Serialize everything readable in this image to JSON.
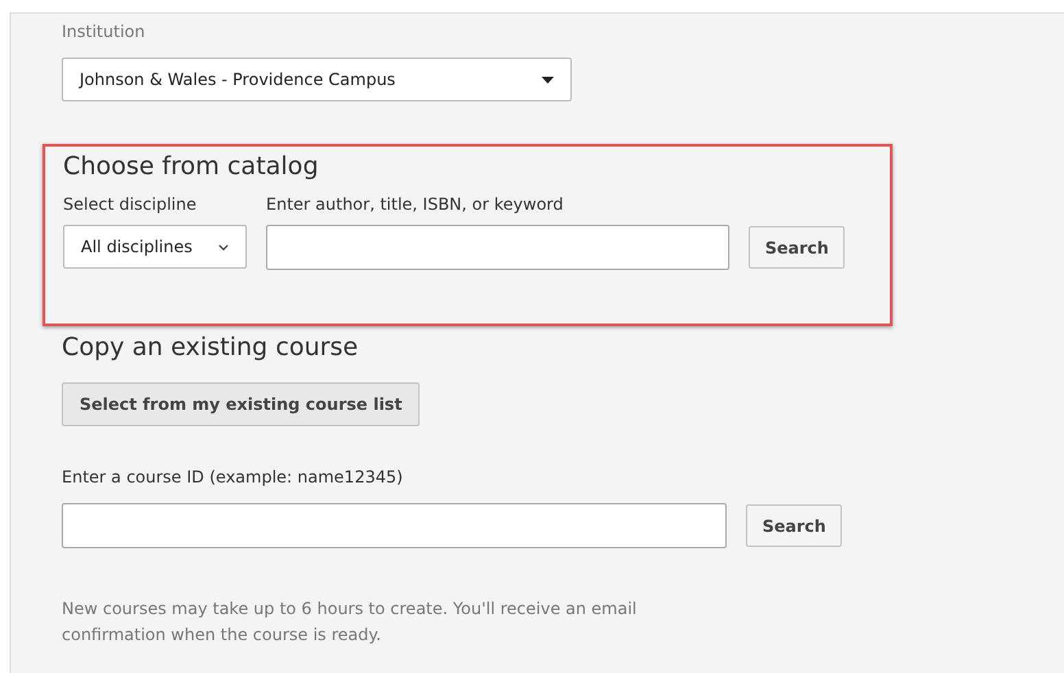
{
  "institution": {
    "label": "Institution",
    "value": "Johnson & Wales - Providence Campus"
  },
  "catalog": {
    "highlighted": true,
    "heading": "Choose from catalog",
    "discipline_label": "Select discipline",
    "discipline_value": "All disciplines",
    "search_label": "Enter author, title, ISBN, or keyword",
    "search_button": "Search"
  },
  "copy": {
    "heading": "Copy an existing course",
    "list_button": "Select from my existing course list",
    "course_id_label": "Enter a course ID (example: name12345)",
    "search_button": "Search"
  },
  "note": "New courses may take up to 6 hours to create. You'll receive an email confirmation when the course is ready."
}
